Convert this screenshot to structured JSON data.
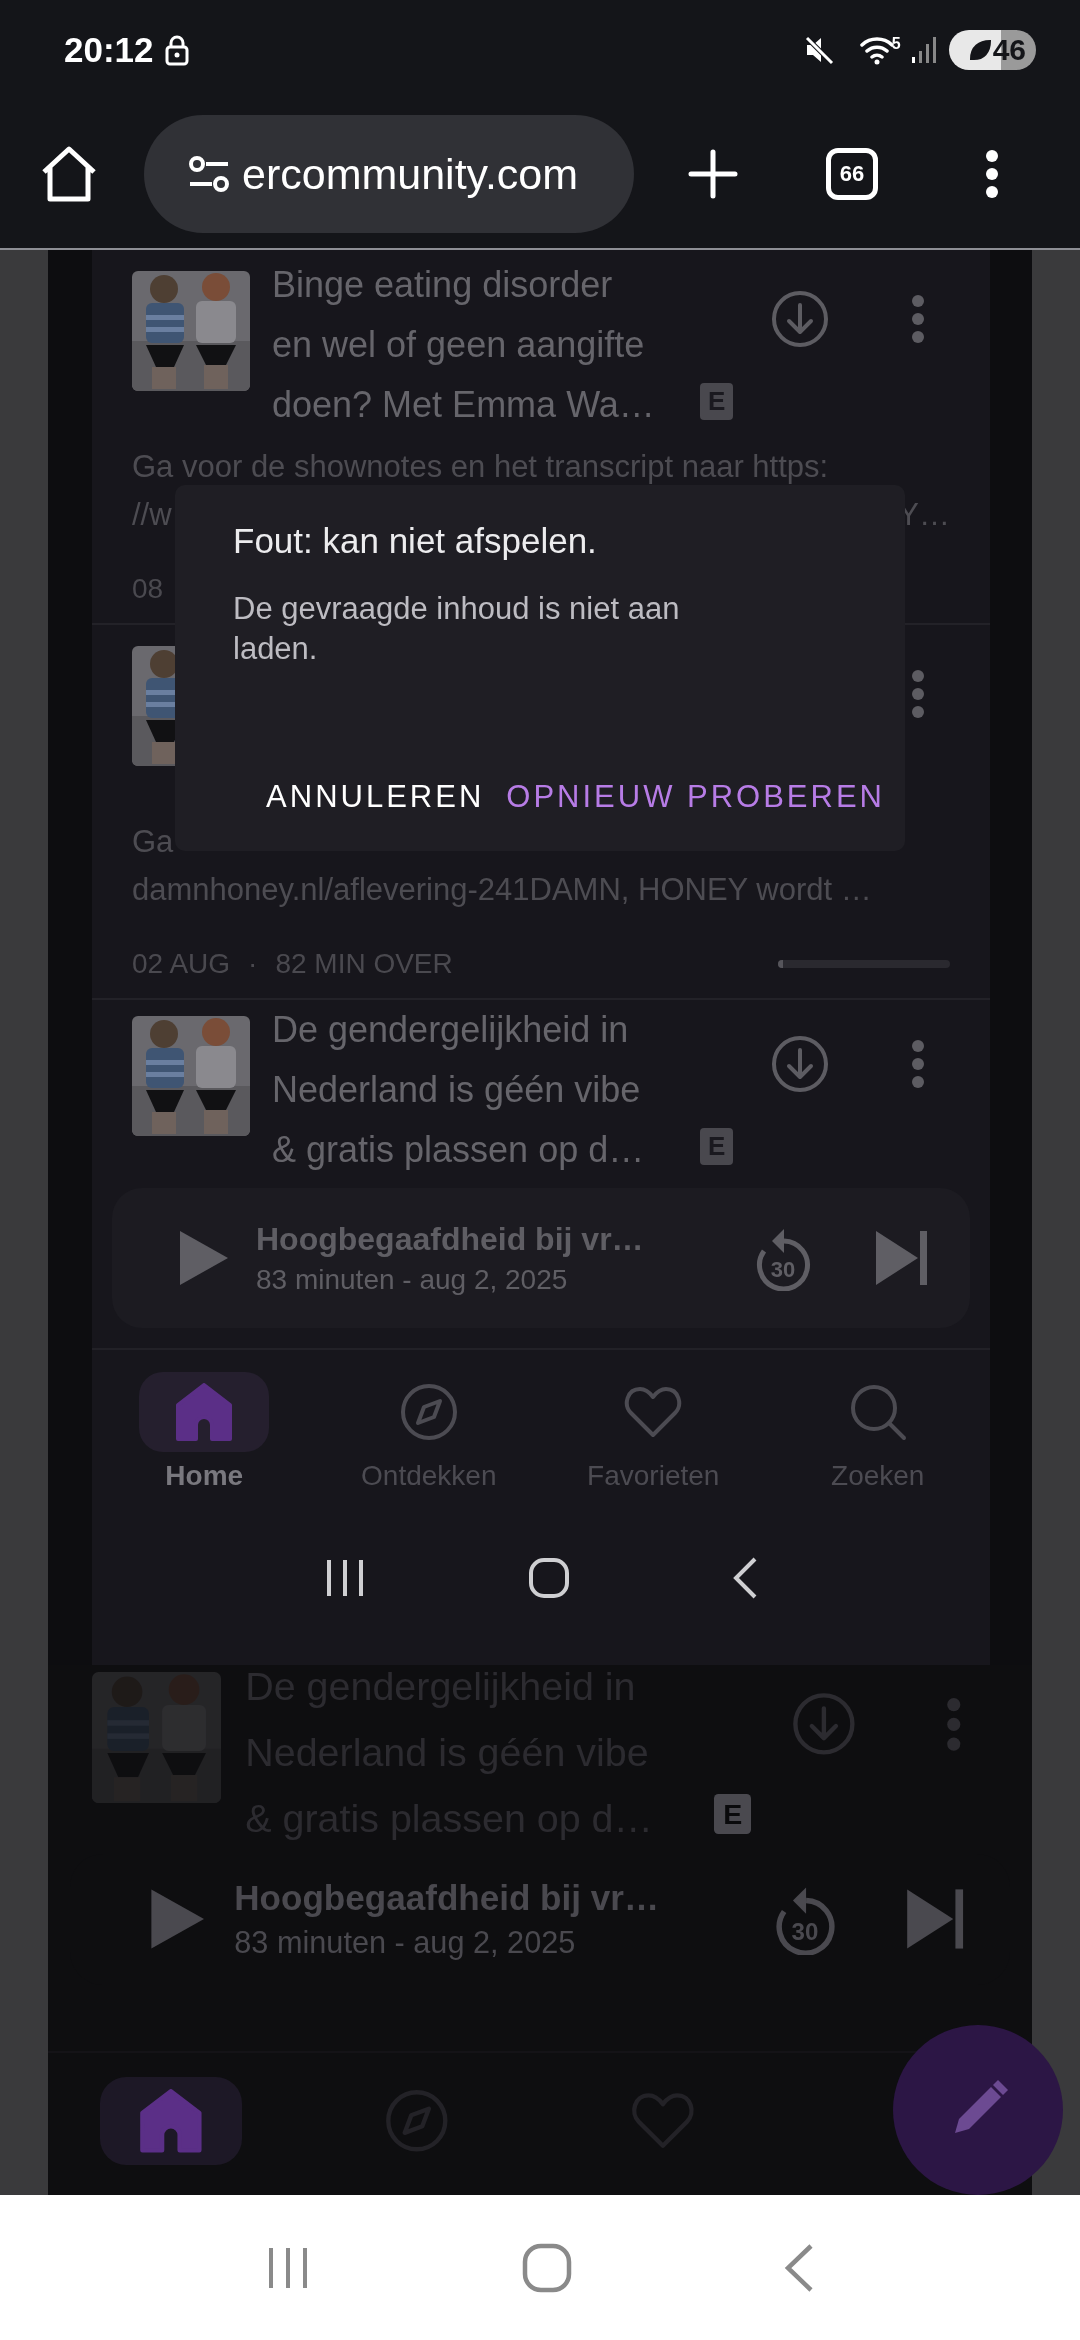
{
  "status_bar": {
    "time": "20:12",
    "wifi_band": "5",
    "battery": "46"
  },
  "browser": {
    "url": "ercommunity.com",
    "tab_count": "66"
  },
  "screens": [
    {
      "kind": "inner",
      "episodes": [
        {
          "title_lines": [
            "Binge eating disorder",
            "en wel of geen aangifte",
            "doen? Met Emma Wa…"
          ],
          "badge": "E",
          "description_lines": [
            [
              "Ga voor de shownotes en het transcript naar https:"
            ],
            [
              "//w",
              "Y…"
            ]
          ],
          "meta": {
            "date": "08"
          }
        },
        {
          "description_lines": [
            [
              "Ga"
            ],
            [
              "damnhoney.nl/aflevering-241DAMN, HONEY wordt …"
            ]
          ],
          "meta": {
            "date": "02 AUG",
            "separator": "·",
            "duration": "82 MIN OVER",
            "level": 0.03
          }
        },
        {
          "title_lines": [
            "De gendergelijkheid in",
            "Nederland is géén vibe",
            "& gratis plassen op d…"
          ],
          "badge": "E"
        }
      ],
      "player": {
        "title": "Hoogbegaafdheid bij vr…",
        "subtitle": "83 minuten - aug 2, 2025",
        "replay": "30"
      },
      "nav_tabs": [
        {
          "kind": "home",
          "label": "Home",
          "selected": true
        },
        {
          "kind": "discover",
          "label": "Ontdekken",
          "selected": false
        },
        {
          "kind": "favorites",
          "label": "Favorieten",
          "selected": false
        },
        {
          "kind": "search",
          "label": "Zoeken",
          "selected": false
        }
      ],
      "dialog": {
        "title": "Fout: kan niet afspelen.",
        "message": "De gevraagde inhoud is niet aan laden.",
        "buttons": [
          {
            "kind": "cancel",
            "label": "ANNULEREN"
          },
          {
            "kind": "confirm",
            "label": "OPNIEUW PROBEREN"
          }
        ]
      }
    },
    {
      "kind": "outer",
      "episodes": [
        {
          "title_lines": [
            "De gendergelijkheid in",
            "Nederland is géén vibe",
            "& gratis plassen op d…"
          ],
          "badge": "E"
        }
      ],
      "player": {
        "title": "Hoogbegaafdheid bij vr…",
        "subtitle": "83 minuten - aug 2, 2025",
        "replay": "30"
      },
      "nav_tabs": [
        {
          "kind": "home",
          "selected": true
        },
        {
          "kind": "discover",
          "selected": false
        },
        {
          "kind": "favorites",
          "selected": false
        }
      ]
    }
  ]
}
